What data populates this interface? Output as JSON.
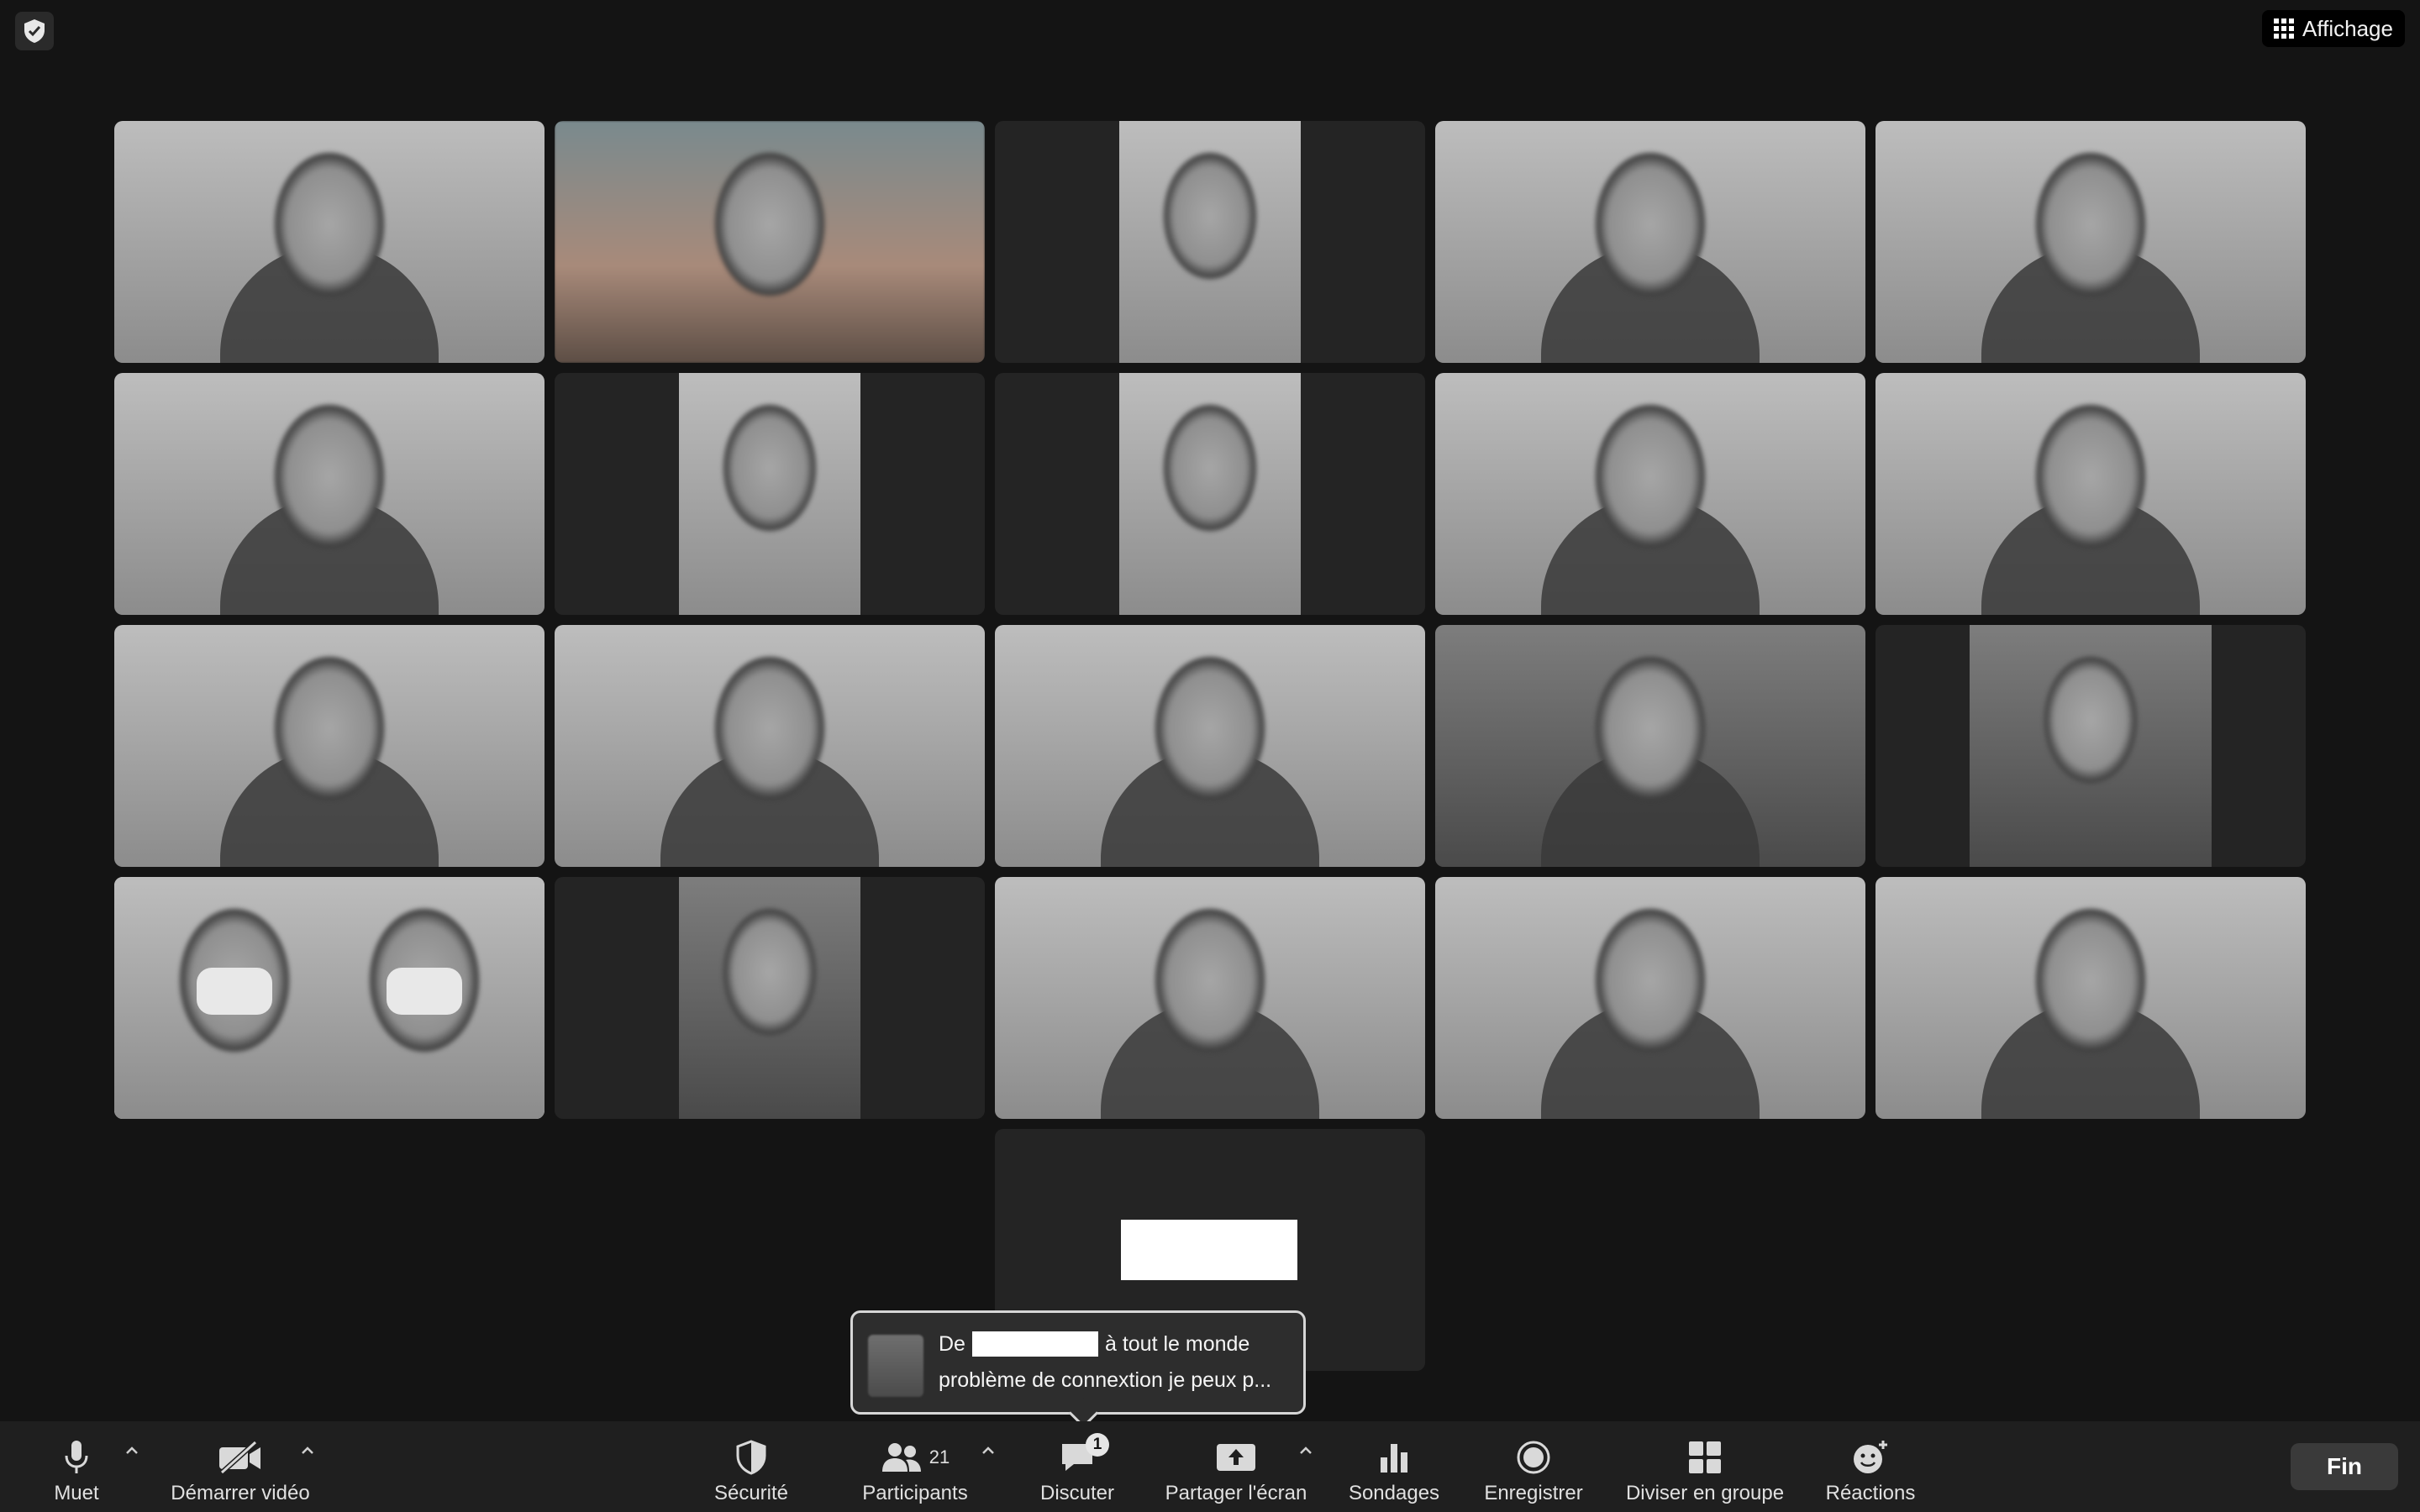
{
  "top": {
    "view_label": "Affichage"
  },
  "gallery": {
    "tiles": [
      {
        "kind": "full"
      },
      {
        "kind": "full"
      },
      {
        "kind": "narrow"
      },
      {
        "kind": "full"
      },
      {
        "kind": "full"
      },
      {
        "kind": "full"
      },
      {
        "kind": "narrow"
      },
      {
        "kind": "narrow"
      },
      {
        "kind": "full"
      },
      {
        "kind": "full"
      },
      {
        "kind": "full"
      },
      {
        "kind": "full"
      },
      {
        "kind": "full"
      },
      {
        "kind": "full"
      },
      {
        "kind": "mid"
      },
      {
        "kind": "full",
        "active": true
      },
      {
        "kind": "narrow"
      },
      {
        "kind": "full"
      },
      {
        "kind": "full"
      },
      {
        "kind": "full"
      },
      {
        "kind": "video-off"
      }
    ]
  },
  "chat_toast": {
    "from_prefix": "De",
    "to_text": "à tout le monde",
    "message": "problème de connextion je peux p..."
  },
  "toolbar": {
    "mute_label": "Muet",
    "video_label": "Démarrer vidéo",
    "security_label": "Sécurité",
    "participants_label": "Participants",
    "participants_count": "21",
    "chat_label": "Discuter",
    "chat_badge": "1",
    "share_label": "Partager l'écran",
    "polls_label": "Sondages",
    "record_label": "Enregistrer",
    "breakout_label": "Diviser en groupe",
    "reactions_label": "Réactions",
    "end_label": "Fin"
  },
  "icons": {
    "security_badge": "shield-check-icon",
    "view": "grid-icon",
    "mute": "microphone-icon",
    "video": "video-off-icon",
    "security": "shield-icon",
    "participants": "people-icon",
    "chat": "chat-bubble-icon",
    "share": "share-screen-icon",
    "polls": "bar-chart-icon",
    "record": "record-icon",
    "breakout": "breakout-grid-icon",
    "reactions": "smiley-plus-icon"
  }
}
